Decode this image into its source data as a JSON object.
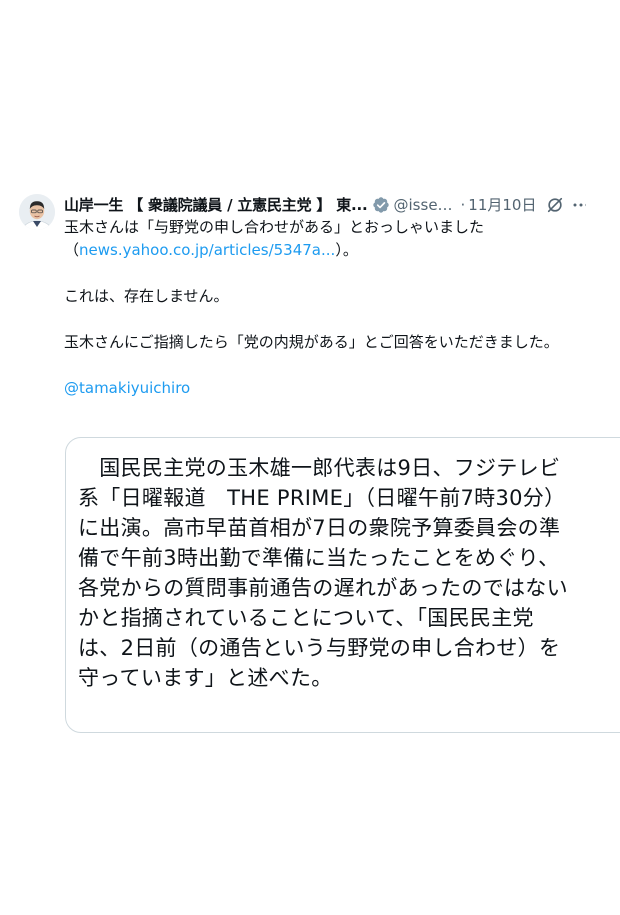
{
  "tweet": {
    "author": {
      "display_name": "山岸一生 【 衆議院議員 / 立憲民主党 】 東...",
      "handle": "@issei...",
      "avatar_icon": "person-avatar-icon",
      "verified_icon": "verified-badge-icon",
      "verified_color": "#829aab"
    },
    "separator": "·",
    "timestamp": "11月10日",
    "body": {
      "line1": "玉木さんは「与野党の申し合わせがある」とおっしゃいました",
      "line2_prefix": "（",
      "link": "news.yahoo.co.jp/articles/5347a...",
      "line2_suffix": "）。",
      "line3": "これは、存在しません。",
      "line4": "玉木さんにご指摘したら「党の内規がある」とご回答をいただきました。",
      "mention": "@tamakiyuichiro"
    },
    "quote": {
      "lines": [
        "　国民民主党の玉木雄一郎代表は9日、フジテレビ",
        "系「日曜報道　THE PRIME」（日曜午前7時30分）",
        "に出演。高市早苗首相が7日の衆院予算委員会の準",
        "備で午前3時出勤で準備に当たったことをめぐり、",
        "各党からの質問事前通告の遅れがあったのではない",
        "かと指摘されていることについて、「国民民主党",
        "は、2日前（の通告という与野党の申し合わせ）を",
        "守っています」と述べた。"
      ]
    },
    "link_color": "#1d9bf0"
  }
}
